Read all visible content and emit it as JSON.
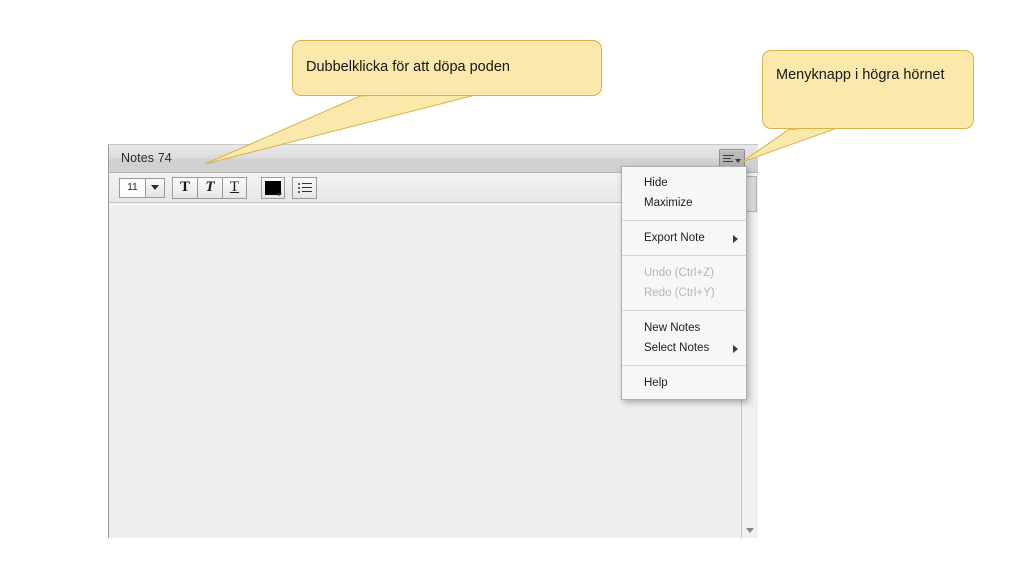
{
  "window": {
    "title": "Notes 74",
    "menu_button_icon": "menu-lines-icon"
  },
  "toolbar": {
    "font_size_value": "11",
    "font_size_dropdown_icon": "chevron-down-icon",
    "bold_label": "T",
    "italic_label": "T",
    "underline_label": "T",
    "color_swatch_color": "#000000",
    "color_dropdown_icon": "chevron-down-icon",
    "list_icon": "bullet-list-icon"
  },
  "context_menu": {
    "groups": [
      {
        "items": [
          {
            "label": "Hide",
            "disabled": false,
            "submenu": false
          },
          {
            "label": "Maximize",
            "disabled": false,
            "submenu": false
          }
        ]
      },
      {
        "items": [
          {
            "label": "Export Note",
            "disabled": false,
            "submenu": true
          }
        ]
      },
      {
        "items": [
          {
            "label": "Undo (Ctrl+Z)",
            "disabled": true,
            "submenu": false
          },
          {
            "label": "Redo (Ctrl+Y)",
            "disabled": true,
            "submenu": false
          }
        ]
      },
      {
        "items": [
          {
            "label": "New Notes",
            "disabled": false,
            "submenu": false
          },
          {
            "label": "Select Notes",
            "disabled": false,
            "submenu": true
          }
        ]
      },
      {
        "items": [
          {
            "label": "Help",
            "disabled": false,
            "submenu": false
          }
        ]
      }
    ]
  },
  "scrollbar": {
    "down_arrow_icon": "triangle-down-icon"
  },
  "callouts": [
    {
      "id": "callout-rename",
      "text": "Dubbelklicka för att döpa poden"
    },
    {
      "id": "callout-menu",
      "text": "Menyknapp i högra hörnet"
    }
  ],
  "colors": {
    "callout_fill": "#fae9ab",
    "callout_border": "#d8b24a",
    "window_body": "#efefef",
    "titlebar": "#dcdcdc"
  }
}
